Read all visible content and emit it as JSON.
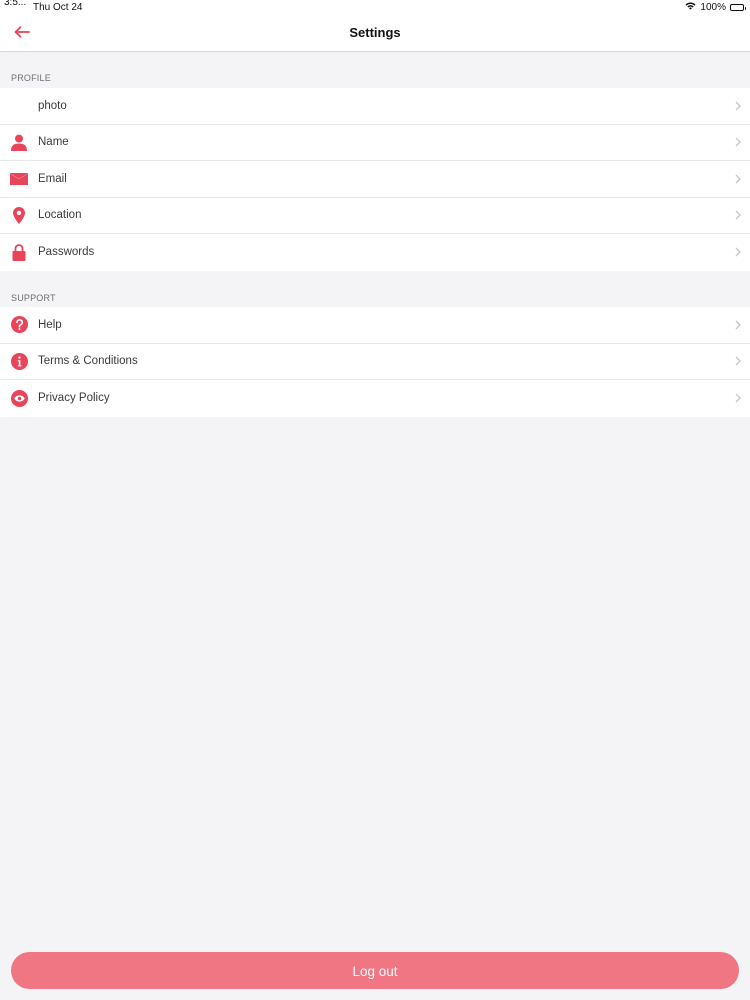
{
  "status_bar": {
    "time": "3:5...",
    "date": "Thu Oct 24",
    "battery": "100%",
    "battery_level": 1.0
  },
  "nav": {
    "title": "Settings"
  },
  "profile": {
    "header": "PROFILE",
    "items": [
      {
        "label": "photo",
        "icon": "none"
      },
      {
        "label": "Name",
        "icon": "person-icon"
      },
      {
        "label": "Email",
        "icon": "envelope-icon"
      },
      {
        "label": "Location",
        "icon": "location-pin-icon"
      },
      {
        "label": "Passwords",
        "icon": "lock-icon"
      }
    ]
  },
  "support": {
    "header": "SUPPORT",
    "items": [
      {
        "label": "Help",
        "icon": "question-icon"
      },
      {
        "label": "Terms & Conditions",
        "icon": "info-icon"
      },
      {
        "label": "Privacy Policy",
        "icon": "eye-icon"
      }
    ]
  },
  "logout": {
    "label": "Log out"
  },
  "colors": {
    "accent": "#e8445a",
    "logout_bg": "#f07684",
    "background": "#f4f3f6",
    "chevron": "#c5c4c9"
  }
}
